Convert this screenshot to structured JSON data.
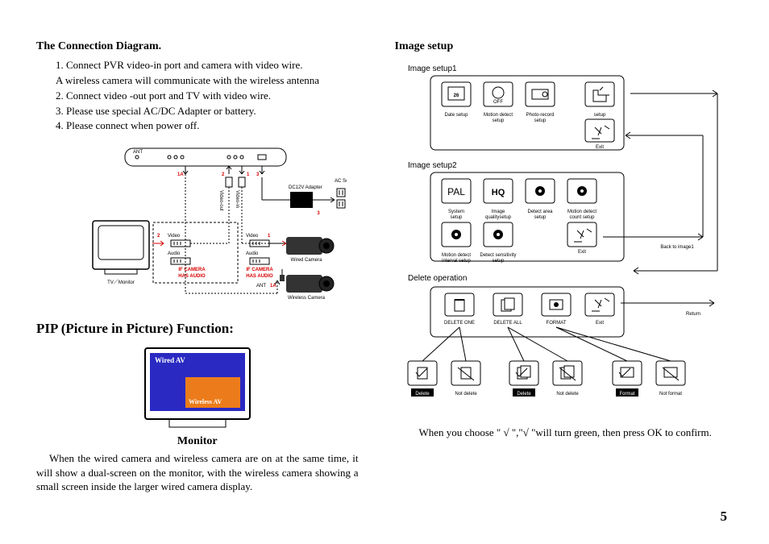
{
  "left": {
    "heading": "The Connection Diagram.",
    "steps": [
      "1. Connect PVR video-in port and camera with video wire.",
      "A wireless camera will communicate with the wireless antenna",
      "2. Connect video -out port and TV with video wire.",
      "3. Please use special AC/DC Adapter or battery.",
      "4. Please connect when power off."
    ],
    "conn": {
      "markers": {
        "m1a_left": "1A",
        "m2": "2",
        "m1": "1",
        "m3": "3",
        "m1a_right": "1A",
        "m3b": "3"
      },
      "ports": {
        "video_out": "Video-out",
        "video_in": "Video-in",
        "dc12v": "DC12V Adapter",
        "ac_socket": "AC Socket"
      },
      "tv": {
        "label": "TV／Monitor",
        "video": "Video",
        "audio": "Audio",
        "if_audio": "IF CAMERA HAS AUDIO"
      },
      "cam": {
        "video": "Video",
        "audio": "Audio",
        "if_audio": "IF CAMERA HAS AUDIO",
        "wired": "Wired Camera",
        "wireless": "Wireless Camera",
        "ant": "ANT"
      }
    },
    "pip": {
      "heading": "PIP (Picture in Picture) Function:",
      "wired": "Wired AV",
      "wireless": "Wireless AV",
      "caption": "Monitor",
      "body": "When the wired camera and wireless camera are on at the same time, it will show a dual-screen on the monitor, with the wireless camera showing a small screen inside the larger wired camera display."
    }
  },
  "right": {
    "heading": "Image setup",
    "setup1": {
      "title": "Image setup1",
      "items": [
        "Date setup",
        "Motion detect setup",
        "Photo-record setup",
        "setup",
        "Exit"
      ],
      "icons": {
        "date": "26",
        "off": "OFF"
      }
    },
    "setup2": {
      "title": "Image setup2",
      "pal": "PAL",
      "items": [
        "System setup",
        "Image qualitysetup",
        "Detect area setup",
        "Motion detect count setup",
        "Motion detect interval setup",
        "Detect sensitivity setup",
        "Exit"
      ],
      "back": "Back to image1"
    },
    "delete": {
      "title": "Delete operation",
      "items": [
        "DELETE ONE",
        "DELETE ALL",
        "FORMAT",
        "Exit"
      ],
      "return": "Return",
      "confirm": [
        "Delete",
        "Not delete",
        "Delete",
        "Not delete",
        "Format",
        "Not format"
      ]
    },
    "confirm_line": "When you choose \" √ \",\"√ \"will turn green, then press OK to confirm."
  },
  "page_number": "5"
}
